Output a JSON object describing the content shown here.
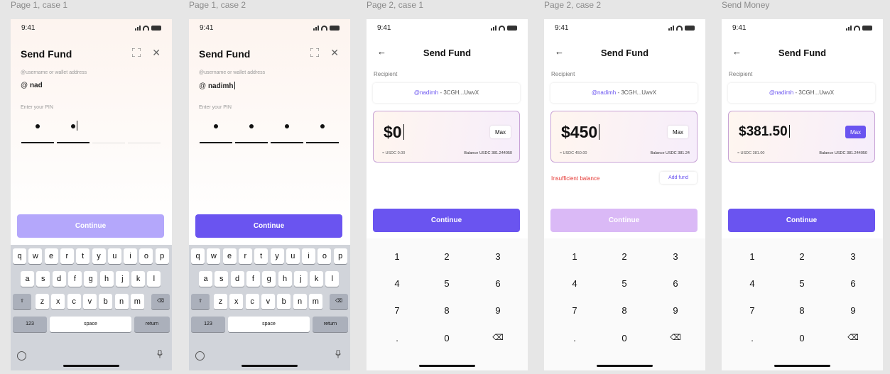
{
  "frames": [
    {
      "label": "Page 1, case 1"
    },
    {
      "label": "Page 1, case 2"
    },
    {
      "label": "Page 2, case 1"
    },
    {
      "label": "Page 2,  case 2"
    },
    {
      "label": "Send Money"
    }
  ],
  "status_bar": {
    "time": "9:41"
  },
  "page1": {
    "title": "Send Fund",
    "username_hint": "@username or wallet address",
    "at_symbol": "@",
    "pin_label": "Enter your PIN",
    "pin_dot": "•",
    "continue_label": "Continue",
    "case1": {
      "username": "nad",
      "pin_filled": 2
    },
    "case2": {
      "username": "nadimh",
      "pin_filled": 4
    },
    "colors": {
      "continue_disabled": "#b4a7fb",
      "continue_enabled": "#6a54f0"
    }
  },
  "keyboard": {
    "row1": [
      "q",
      "w",
      "e",
      "r",
      "t",
      "y",
      "u",
      "i",
      "o",
      "p"
    ],
    "row2": [
      "a",
      "s",
      "d",
      "f",
      "g",
      "h",
      "j",
      "k",
      "l"
    ],
    "row3": [
      "z",
      "x",
      "c",
      "v",
      "b",
      "n",
      "m"
    ],
    "shift_glyph": "⇧",
    "delete_glyph": "⌫",
    "numbers_label": "123",
    "space_label": "space",
    "return_label": "return",
    "icons": [
      "emoji-icon",
      "microphone-icon"
    ]
  },
  "page2": {
    "title": "Send Fund",
    "back_glyph": "←",
    "recipient_label": "Recipient",
    "recipient_handle": "@nadimh",
    "recipient_address": " - 3CGH...UwvX",
    "max_label": "Max",
    "continue_label": "Continue",
    "insufficient_label": "Insufficient balance",
    "add_fund_label": "Add fund",
    "numpad": [
      "1",
      "2",
      "3",
      "4",
      "5",
      "6",
      "7",
      "8",
      "9",
      ".",
      "0",
      "⌫"
    ],
    "case1": {
      "amount": "$0",
      "usdc": "≈ USDC 0.00",
      "balance": "Balance USDC 381.244050"
    },
    "case2": {
      "amount": "$450",
      "usdc": "≈ USDC 450.00",
      "balance": "Balance USDC 381.24"
    },
    "send_money": {
      "amount": "$381.50",
      "usdc": "≈ USDC 381.00",
      "balance": "Balance USDC 381.244050"
    },
    "colors": {
      "accent": "#6a54f0",
      "continue_disabled": "#dab9f6",
      "error": "#e53935"
    }
  }
}
